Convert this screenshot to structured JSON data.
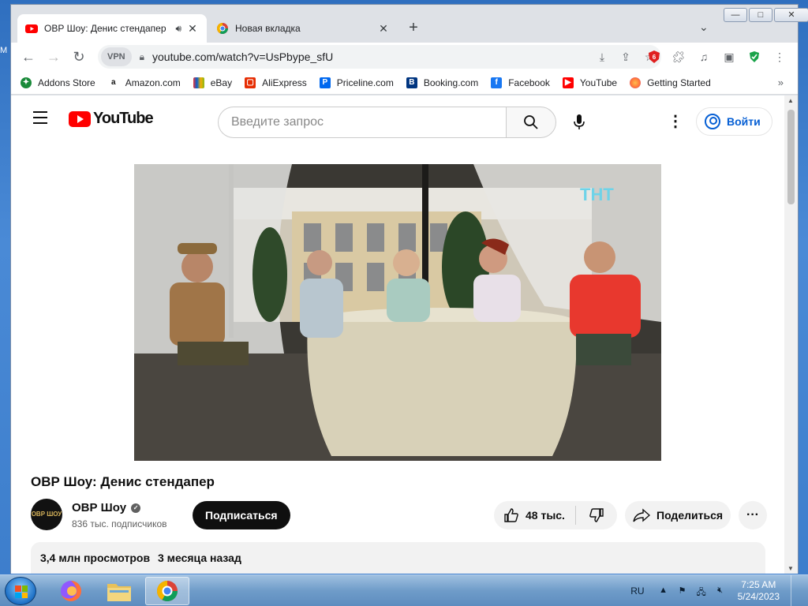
{
  "desktop": {
    "edge_label": "M"
  },
  "tabs": [
    {
      "title": "ОВР Шоу: Денис стендапер",
      "active": true,
      "audio": true
    },
    {
      "title": "Новая вкладка",
      "active": false
    }
  ],
  "window_controls": {
    "minimize": "—",
    "maximize": "□",
    "close": "✕"
  },
  "toolbar": {
    "vpn_label": "VPN",
    "url": "youtube.com/watch?v=UsPbype_sfU",
    "extension_badge": "6"
  },
  "bookmarks": [
    {
      "label": "Addons Store",
      "icon": "addons-icon",
      "color": "#1a8a3a"
    },
    {
      "label": "Amazon.com",
      "icon": "amazon-icon",
      "color": "#111111"
    },
    {
      "label": "eBay",
      "icon": "ebay-icon",
      "color": "#e53238"
    },
    {
      "label": "AliExpress",
      "icon": "aliexpress-icon",
      "color": "#e62e04"
    },
    {
      "label": "Priceline.com",
      "icon": "priceline-icon",
      "color": "#0068ef"
    },
    {
      "label": "Booking.com",
      "icon": "booking-icon",
      "color": "#003580"
    },
    {
      "label": "Facebook",
      "icon": "facebook-icon",
      "color": "#1877f2"
    },
    {
      "label": "YouTube",
      "icon": "youtube-icon",
      "color": "#ff0000"
    },
    {
      "label": "Getting Started",
      "icon": "firefox-icon",
      "color": "#ff7139"
    }
  ],
  "youtube": {
    "logo_text": "YouTube",
    "search_placeholder": "Введите запрос",
    "signin_label": "Войти",
    "video_watermark": "ТНТ",
    "video_title": "ОВР Шоу: Денис стендапер",
    "channel_name": "ОВР Шоу",
    "channel_avatar_text": "ОВР ШОУ",
    "subscribers": "836 тыс. подписчиков",
    "subscribe_label": "Подписаться",
    "likes": "48 тыс.",
    "share_label": "Поделиться",
    "views": "3,4 млн просмотров",
    "published": "3 месяца назад"
  },
  "taskbar": {
    "language": "RU",
    "time": "7:25 AM",
    "date": "5/24/2023"
  },
  "colors": {
    "youtube_red": "#ff0000",
    "signin_blue": "#065fd4",
    "subscribe_bg": "#0f0f0f"
  }
}
